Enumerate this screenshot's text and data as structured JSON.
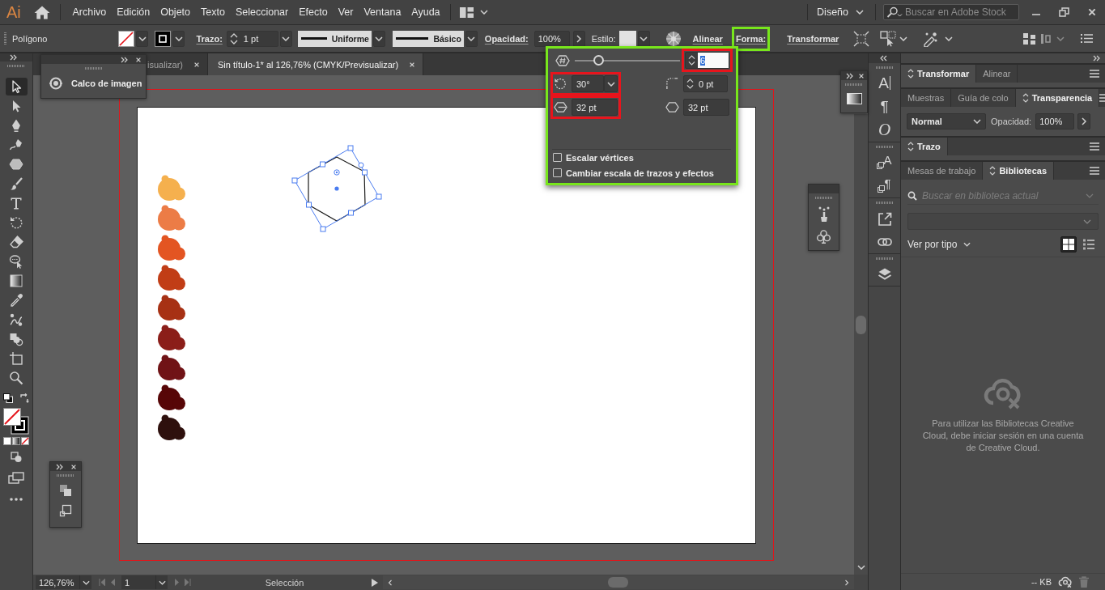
{
  "menu_bar": {
    "logo": "Ai",
    "items": [
      "Archivo",
      "Edición",
      "Objeto",
      "Texto",
      "Seleccionar",
      "Efecto",
      "Ver",
      "Ventana",
      "Ayuda"
    ],
    "workspace": "Diseño",
    "stock_search": {
      "placeholder": "Buscar en Adobe Stock"
    }
  },
  "control_bar": {
    "tool_name": "Polígono",
    "stroke_label": "Trazo:",
    "stroke_weight": "1 pt",
    "stroke_profile": "Uniforme",
    "brush": "Básico",
    "opacity_label": "Opacidad:",
    "opacity": "100%",
    "style_label": "Estilo:",
    "links": [
      {
        "label": "Alinear",
        "highlighted": false
      },
      {
        "label": "Forma:",
        "highlighted": true
      },
      {
        "label": "Transformar",
        "highlighted": false
      }
    ]
  },
  "shape_popup": {
    "highlighted": true,
    "sides": {
      "level": 0.2,
      "value": "6",
      "value_selected": true,
      "marked": true
    },
    "fields": [
      {
        "kind": "angle",
        "value": "30°",
        "marked": true
      },
      {
        "kind": "corner-radius",
        "value": "0 pt",
        "marked": false
      },
      {
        "kind": "side-length",
        "value": "32 pt",
        "marked": true
      },
      {
        "kind": "radius",
        "value": "32 pt",
        "marked": false
      }
    ],
    "options": [
      {
        "label": "Escalar vértices",
        "checked": false
      },
      {
        "label": "Cambiar escala de trazos y efectos",
        "checked": false
      }
    ]
  },
  "image_trace_panel": {
    "title": "Calco de imagen"
  },
  "document_tabs": [
    {
      "label": "isualizar)",
      "selected": false
    },
    {
      "label": "Sin título-1* al 126,76% (CMYK/Previsualizar)",
      "selected": true
    }
  ],
  "tools": [
    {
      "kind": "selection",
      "selected": true
    },
    {
      "kind": "direct-selection",
      "selected": false
    },
    {
      "kind": "pen",
      "selected": false
    },
    {
      "kind": "curvature",
      "selected": false
    },
    {
      "kind": "polygon",
      "selected": false
    },
    {
      "kind": "paintbrush",
      "selected": false
    },
    {
      "kind": "type",
      "selected": false
    },
    {
      "kind": "rotate",
      "selected": false
    },
    {
      "kind": "eraser",
      "selected": false
    },
    {
      "kind": "lasso",
      "selected": false
    },
    {
      "kind": "gradient",
      "selected": false
    },
    {
      "kind": "eyedropper",
      "selected": false
    },
    {
      "kind": "blend",
      "selected": false
    },
    {
      "kind": "shape-builder",
      "selected": false
    },
    {
      "kind": "artboard",
      "selected": false
    },
    {
      "kind": "zoom",
      "selected": false
    }
  ],
  "artboard": {
    "blobs": [
      {
        "color": "#f5b04e"
      },
      {
        "color": "#ec7c46"
      },
      {
        "color": "#e35522"
      },
      {
        "color": "#c13d16"
      },
      {
        "color": "#a73114"
      },
      {
        "color": "#8b1e19"
      },
      {
        "color": "#701316"
      },
      {
        "color": "#570607"
      },
      {
        "color": "#2e100d"
      }
    ]
  },
  "status_bar": {
    "zoom": "126,76%",
    "artboard_number": "1",
    "current_tool": "Selección"
  },
  "dock_groups": [
    {
      "items": [
        {
          "kind": "character",
          "glyph": "A"
        },
        {
          "kind": "paragraph",
          "glyph": "¶"
        },
        {
          "kind": "opentype",
          "glyph": "O"
        }
      ]
    },
    {
      "items": [
        {
          "kind": "character-styles",
          "glyph": "A"
        },
        {
          "kind": "paragraph-styles",
          "glyph": "¶"
        }
      ]
    },
    {
      "items": [
        {
          "kind": "export"
        },
        {
          "kind": "links"
        }
      ]
    },
    {
      "items": [
        {
          "kind": "layers"
        }
      ]
    }
  ],
  "right_panel": {
    "transform_tabs": [
      {
        "label": "Transformar",
        "selected": true
      },
      {
        "label": "Alinear",
        "selected": false
      }
    ],
    "color_tabs": [
      {
        "label": "Muestras",
        "selected": false
      },
      {
        "label": "Guía de colo",
        "selected": false
      },
      {
        "label": "Transparencia",
        "selected": true
      }
    ],
    "blend_mode": "Normal",
    "opacity_label": "Opacidad:",
    "opacity": "100%",
    "stroke_tabs": [
      {
        "label": "Trazo",
        "selected": true
      }
    ],
    "library_tabs": [
      {
        "label": "Mesas de trabajo",
        "selected": false
      },
      {
        "label": "Bibliotecas",
        "selected": true
      }
    ],
    "library_search": {
      "placeholder": "Buscar en biblioteca actual"
    },
    "view_label": "Ver por tipo",
    "view_modes": [
      {
        "kind": "grid",
        "selected": true
      },
      {
        "kind": "list",
        "selected": false
      }
    ],
    "message": "Para utilizar las Bibliotecas Creative Cloud, debe iniciar sesión en una cuenta de Creative Cloud.",
    "storage": "-- KB"
  }
}
